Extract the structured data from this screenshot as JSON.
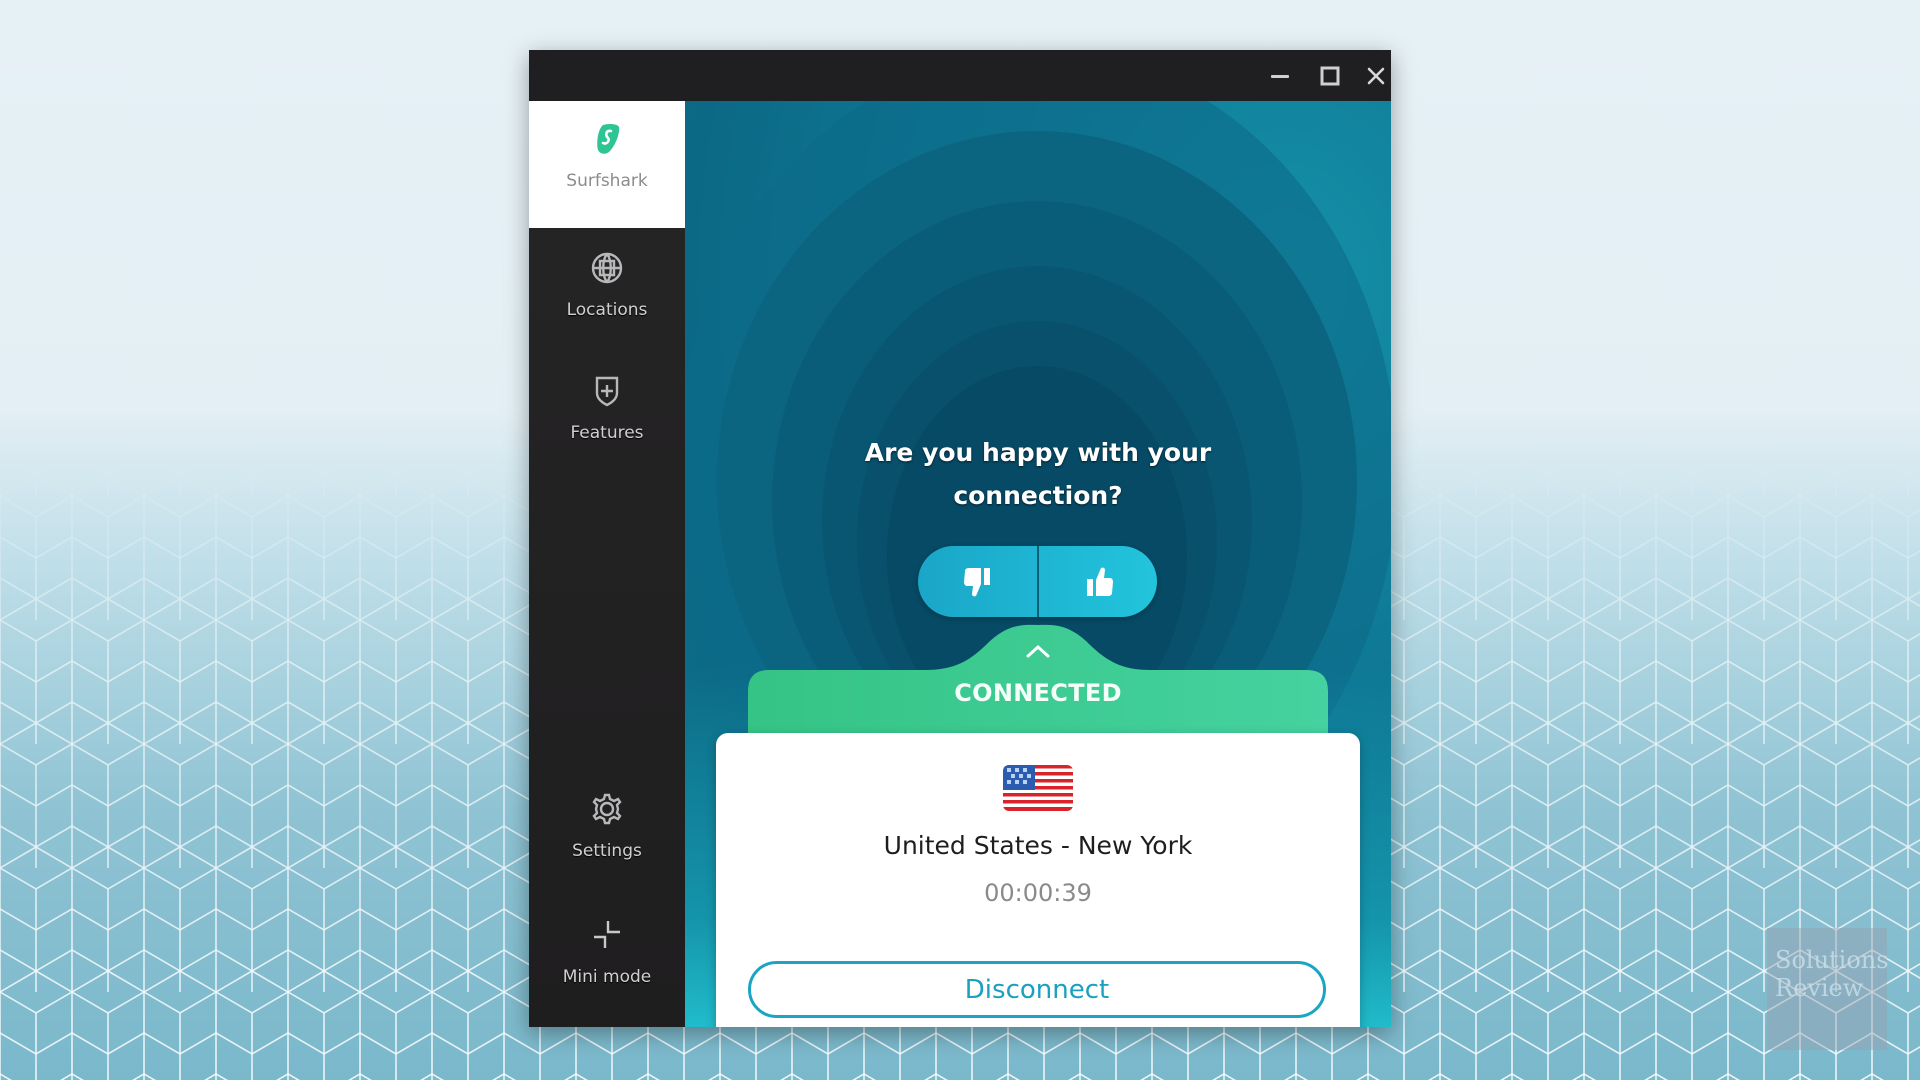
{
  "window": {
    "controls": {
      "minimize": "minimize-icon",
      "maximize": "maximize-icon",
      "close": "close-icon"
    }
  },
  "sidebar": {
    "brand": {
      "label": "Surfshark",
      "icon": "surfshark-logo-icon"
    },
    "items": [
      {
        "label": "Locations",
        "icon": "globe-icon"
      },
      {
        "label": "Features",
        "icon": "shield-plus-icon"
      },
      {
        "label": "Settings",
        "icon": "gear-icon"
      },
      {
        "label": "Mini mode",
        "icon": "minimize-arrows-icon"
      }
    ]
  },
  "feedback": {
    "question_line1": "Are you happy with your",
    "question_line2": "connection?",
    "thumbs_down": "thumbs-down-icon",
    "thumbs_up": "thumbs-up-icon"
  },
  "connection": {
    "status": "CONNECTED",
    "country_flag": "us-flag-icon",
    "location": "United States - New York",
    "duration": "00:00:39",
    "disconnect_label": "Disconnect"
  },
  "colors": {
    "accent_green": "#3ec98f",
    "accent_teal": "#1aa5c4",
    "sidebar_bg": "#232223",
    "titlebar_bg": "#1f1e20"
  },
  "watermark": {
    "line1": "Solutions",
    "line2": "Review"
  }
}
